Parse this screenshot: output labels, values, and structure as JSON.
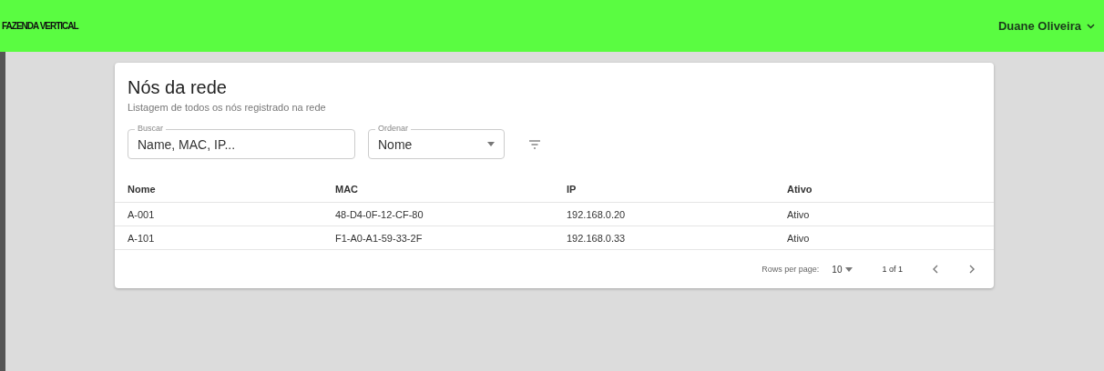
{
  "header": {
    "brand": "FAZENDA VERTICAL",
    "user": "Duane Oliveira"
  },
  "card": {
    "title": "Nós da rede",
    "subtitle": "Listagem de todos os nós registrado na rede"
  },
  "search": {
    "label": "Buscar",
    "placeholder": "Name, MAC, IP..."
  },
  "sort": {
    "label": "Ordenar",
    "value": "Nome"
  },
  "table": {
    "columns": [
      "Nome",
      "MAC",
      "IP",
      "Ativo"
    ],
    "rows": [
      [
        "A-001",
        "48-D4-0F-12-CF-80",
        "192.168.0.20",
        "Ativo"
      ],
      [
        "A-101",
        "F1-A0-A1-59-33-2F",
        "192.168.0.33",
        "Ativo"
      ]
    ]
  },
  "pagination": {
    "rows_label": "Rows per page:",
    "rows_value": "10",
    "range": "1 of 1"
  }
}
